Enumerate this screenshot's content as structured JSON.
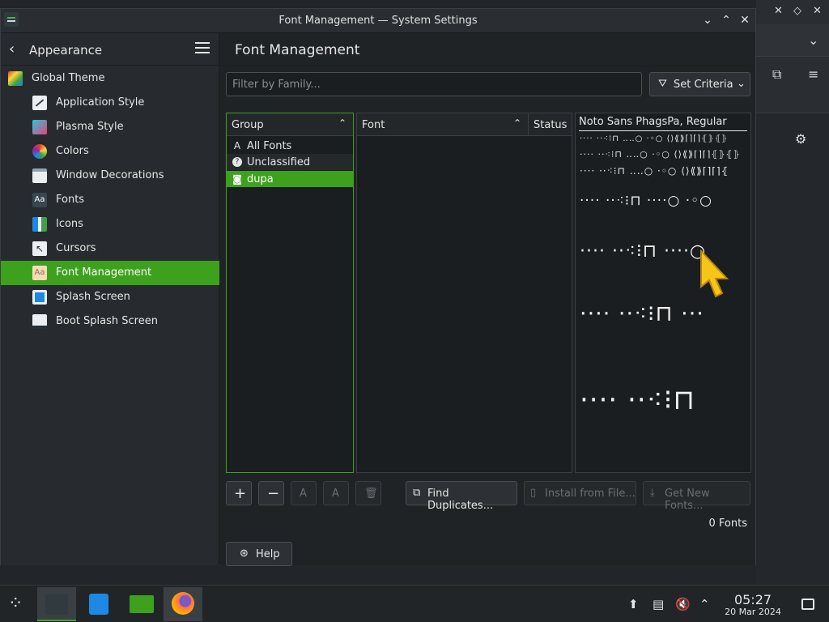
{
  "window": {
    "title": "Font Management — System Settings"
  },
  "sidebar": {
    "header": "Appearance",
    "items": [
      {
        "label": "Global Theme",
        "icon": "global-theme-icon",
        "active": false
      },
      {
        "label": "Application Style",
        "icon": "application-style-icon",
        "active": false
      },
      {
        "label": "Plasma Style",
        "icon": "plasma-style-icon",
        "active": false
      },
      {
        "label": "Colors",
        "icon": "colors-icon",
        "active": false
      },
      {
        "label": "Window Decorations",
        "icon": "window-decorations-icon",
        "active": false
      },
      {
        "label": "Fonts",
        "icon": "fonts-icon",
        "active": false
      },
      {
        "label": "Icons",
        "icon": "icons-icon",
        "active": false
      },
      {
        "label": "Cursors",
        "icon": "cursors-icon",
        "active": false
      },
      {
        "label": "Font Management",
        "icon": "font-management-icon",
        "active": true
      },
      {
        "label": "Splash Screen",
        "icon": "splash-screen-icon",
        "active": false
      },
      {
        "label": "Boot Splash Screen",
        "icon": "boot-splash-screen-icon",
        "active": false
      }
    ]
  },
  "main": {
    "title": "Font Management",
    "filter_placeholder": "Filter by Family...",
    "set_criteria": "Set Criteria",
    "group_header": "Group",
    "groups": [
      {
        "label": "All Fonts",
        "icon": "A"
      },
      {
        "label": "Unclassified",
        "icon": "?"
      },
      {
        "label": "dupa",
        "icon": "◙"
      }
    ],
    "font_header": "Font",
    "status_header": "Status",
    "preview_title": "Noto Sans PhagsPa, Regular",
    "preview_rows": [
      "···· ··⁖⁝⊓ ‥‥○ ·◦○ ⟨⟩⟪⟫⌈⌉⌈⌉⦃⦄⦃⦄",
      "···· ··⁖⁝⊓ ‥‥○ ·◦○ ⟨⟩⟪⟫⌈⌉⌈⌉⦃⦄⦃⦄",
      "···· ··⁖⁝⊓ ‥‥○ ·◦○ ⟨⟩⟪⟫⌈⌉⌈⌉⦃",
      "···· ··⁖⁝⊓ ····○ ·◦○",
      "···· ··⁖⁝⊓ ····○",
      "···· ··⁖⁝⊓ ···",
      "···· ··⁖⁝⊓"
    ],
    "buttons": {
      "add": "+",
      "remove": "−",
      "find_duplicates": "Find Duplicates...",
      "install_from_file": "Install from File...",
      "get_new_fonts": "Get New Fonts..."
    },
    "font_count": "0 Fonts",
    "help": "Help"
  },
  "taskbar": {
    "time": "05:27",
    "date": "20 Mar 2024"
  },
  "colors": {
    "accent": "#3da11e",
    "background": "#202326",
    "sidebar": "#272a2e"
  }
}
